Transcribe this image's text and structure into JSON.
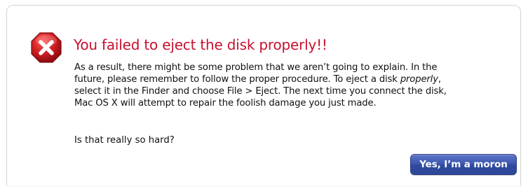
{
  "dialog": {
    "title": "You failed to eject the disk properly!!",
    "icon": "error-x-icon",
    "message": {
      "line1": "As a result, there might be some problem that we aren’t going to explain. In the",
      "line2": "future, please remember to follow the proper procedure. To eject a disk ",
      "line2_emphasis": "properly",
      "line2_end": ",",
      "line3": "select it in the Finder and choose File > Eject. The next time you connect the disk,",
      "line4": "Mac OS X will attempt to repair the foolish damage you just made."
    },
    "question": "Is that really so hard?",
    "button_label": "Yes, I’m a moron"
  },
  "colors": {
    "title": "#c8102e",
    "icon": "#c0182a",
    "button": "#3d56ad"
  }
}
